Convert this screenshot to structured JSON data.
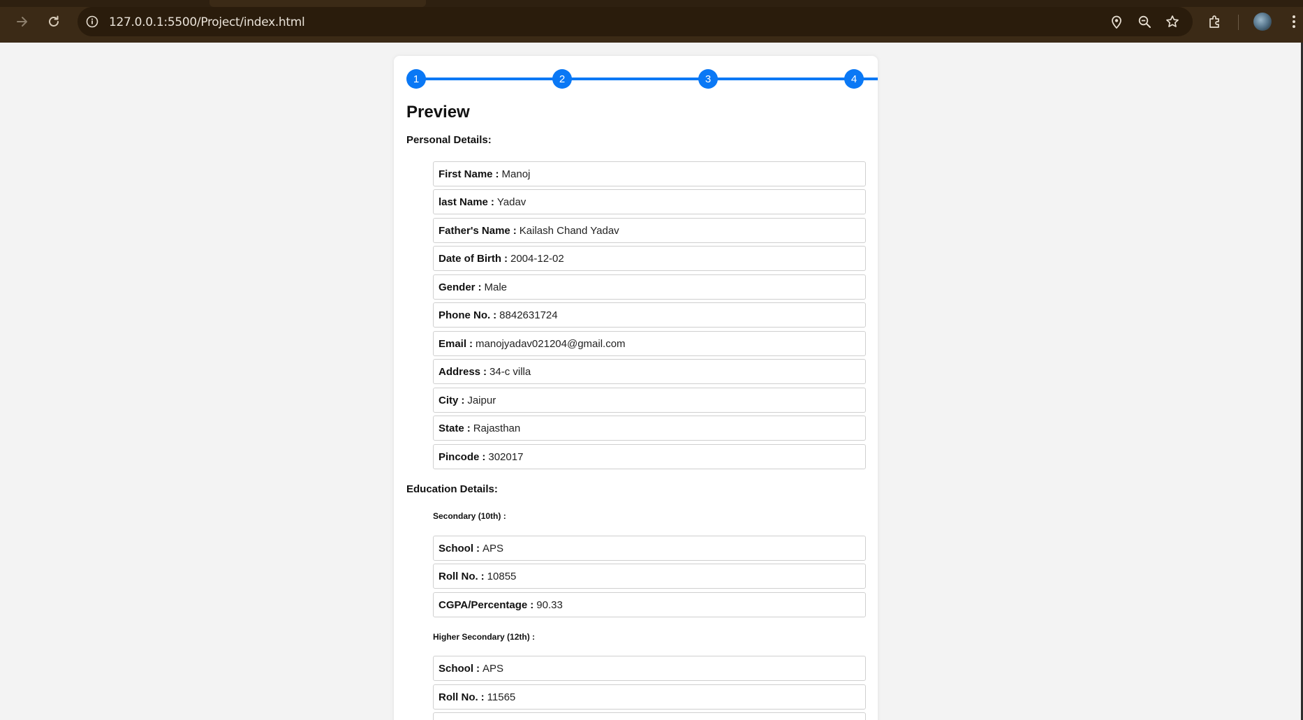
{
  "browser": {
    "url": "127.0.0.1:5500/Project/index.html",
    "icons": {
      "forward": "forward-arrow-icon",
      "reload": "reload-icon",
      "site_info": "info-icon",
      "location": "location-pin-icon",
      "zoom": "zoom-icon",
      "bookmark": "star-icon",
      "extensions": "puzzle-icon",
      "menu": "more-vert-icon"
    }
  },
  "stepper": {
    "steps": [
      "1",
      "2",
      "3",
      "4"
    ],
    "color": "#0a78f5"
  },
  "preview": {
    "title": "Preview",
    "personal": {
      "heading": "Personal Details:",
      "fields": [
        {
          "label": "First Name",
          "value": "Manoj"
        },
        {
          "label": "last Name",
          "value": "Yadav"
        },
        {
          "label": "Father's Name",
          "value": "Kailash Chand Yadav"
        },
        {
          "label": "Date of Birth",
          "value": "2004-12-02"
        },
        {
          "label": "Gender",
          "value": "Male"
        },
        {
          "label": "Phone No.",
          "value": "8842631724"
        },
        {
          "label": "Email",
          "value": "manojyadav021204@gmail.com"
        },
        {
          "label": "Address",
          "value": "34-c villa"
        },
        {
          "label": "City",
          "value": "Jaipur"
        },
        {
          "label": "State",
          "value": "Rajasthan"
        },
        {
          "label": "Pincode",
          "value": "302017"
        }
      ]
    },
    "education": {
      "heading": "Education Details:",
      "secondary": {
        "heading": "Secondary (10th) :",
        "fields": [
          {
            "label": "School",
            "value": "APS"
          },
          {
            "label": "Roll No.",
            "value": "10855"
          },
          {
            "label": "CGPA/Percentage",
            "value": "90.33"
          }
        ]
      },
      "higher_secondary": {
        "heading": "Higher Secondary (12th) :",
        "fields": [
          {
            "label": "School",
            "value": "APS"
          },
          {
            "label": "Roll No.",
            "value": "11565"
          }
        ]
      }
    },
    "colon": ":"
  }
}
